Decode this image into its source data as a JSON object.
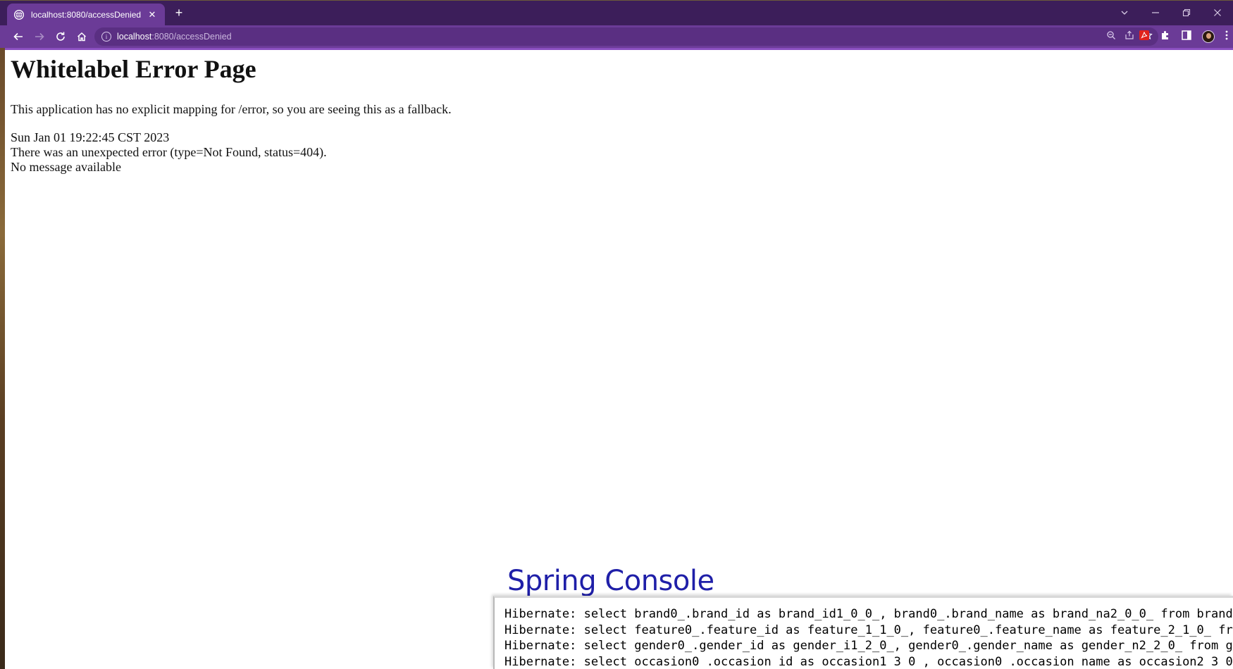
{
  "browser": {
    "tab": {
      "title": "localhost:8080/accessDenied",
      "close": "✕"
    },
    "new_tab": "+",
    "address": {
      "host": "localhost",
      "path": ":8080/accessDenied"
    },
    "theme_color": "#6b3b97"
  },
  "page": {
    "title": "Whitelabel Error Page",
    "description": "This application has no explicit mapping for /error, so you are seeing this as a fallback.",
    "timestamp": "Sun Jan 01 19:22:45 CST 2023",
    "error": "There was an unexpected error (type=Not Found, status=404).",
    "message": "No message available"
  },
  "console": {
    "label": "Spring Console",
    "lines": [
      "Hibernate: select brand0_.brand_id as brand_id1_0_0_, brand0_.brand_name as brand_na2_0_0_ from brand",
      "Hibernate: select feature0_.feature_id as feature_1_1_0_, feature0_.feature_name as feature_2_1_0_ fr",
      "Hibernate: select gender0_.gender_id as gender_i1_2_0_, gender0_.gender_name as gender_n2_2_0_ from g",
      "Hibernate: select occasion0 .occasion id as occasion1 3 0 , occasion0 .occasion name as occasion2 3 0"
    ]
  }
}
